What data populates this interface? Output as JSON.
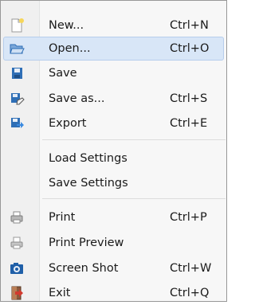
{
  "menu": {
    "items": [
      {
        "icon": "new-file-icon",
        "label": "New...",
        "shortcut": "Ctrl+N"
      },
      {
        "icon": "open-folder-icon",
        "label": "Open...",
        "shortcut": "Ctrl+O",
        "highlighted": true
      },
      {
        "icon": "save-disk-icon",
        "label": "Save",
        "shortcut": ""
      },
      {
        "icon": "save-as-icon",
        "label": "Save as...",
        "shortcut": "Ctrl+S"
      },
      {
        "icon": "export-icon",
        "label": "Export",
        "shortcut": "Ctrl+E"
      },
      {
        "icon": "",
        "label": "Load Settings",
        "shortcut": ""
      },
      {
        "icon": "",
        "label": "Save Settings",
        "shortcut": ""
      },
      {
        "icon": "printer-icon",
        "label": "Print",
        "shortcut": "Ctrl+P"
      },
      {
        "icon": "print-preview-icon",
        "label": "Print Preview",
        "shortcut": ""
      },
      {
        "icon": "camera-icon",
        "label": "Screen Shot",
        "shortcut": "Ctrl+W"
      },
      {
        "icon": "exit-door-icon",
        "label": "Exit",
        "shortcut": "Ctrl+Q"
      }
    ]
  },
  "colors": {
    "highlight": "#d8e6f7",
    "highlight_border": "#b6cdec",
    "icon_blue": "#2f6fb6",
    "exit_red": "#d23b2f"
  }
}
